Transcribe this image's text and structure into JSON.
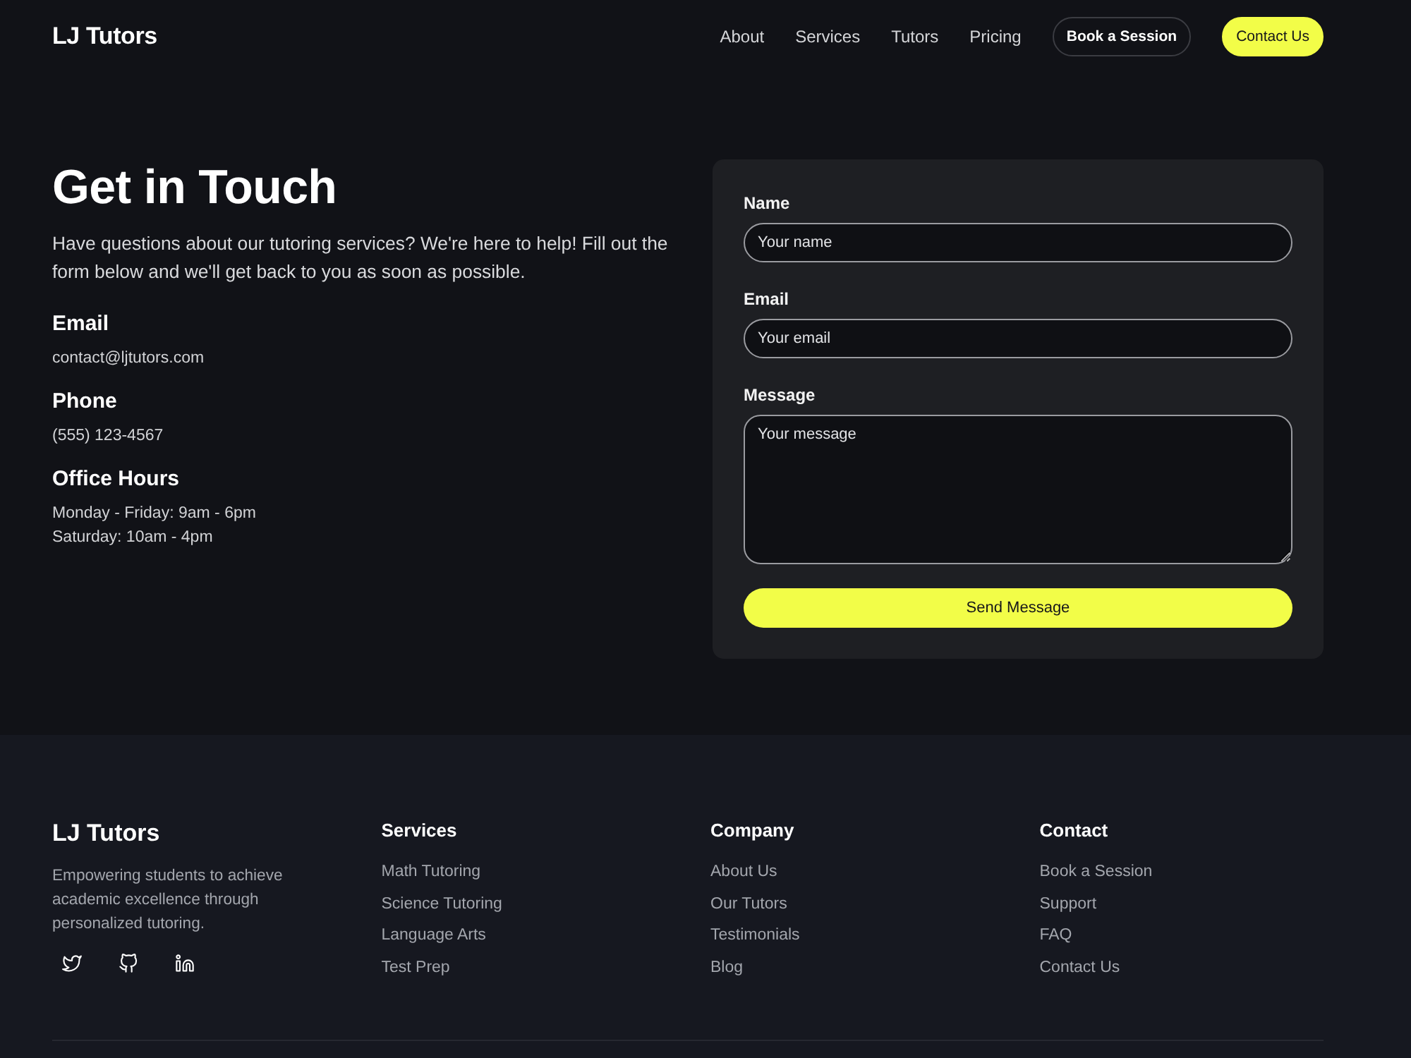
{
  "header": {
    "logo": "LJ Tutors",
    "nav_links": [
      "About",
      "Services",
      "Tutors",
      "Pricing"
    ],
    "buttons": [
      {
        "label": "Book a Session",
        "kind": "outline"
      },
      {
        "label": "Contact Us",
        "kind": "primary"
      }
    ]
  },
  "contact": {
    "title": "Get in Touch",
    "intro": "Have questions about our tutoring services? We're here to help! Fill out the form below and we'll get back to you as soon as possible.",
    "details": [
      {
        "heading": "Email",
        "lines": [
          "contact@ljtutors.com"
        ]
      },
      {
        "heading": "Phone",
        "lines": [
          "(555) 123-4567"
        ]
      },
      {
        "heading": "Office Hours",
        "lines": [
          "Monday - Friday: 9am - 6pm",
          "Saturday: 10am - 4pm"
        ]
      }
    ]
  },
  "form": {
    "fields": [
      {
        "label": "Name",
        "placeholder": "Your name",
        "kind": "input"
      },
      {
        "label": "Email",
        "placeholder": "Your email",
        "kind": "input"
      },
      {
        "label": "Message",
        "placeholder": "Your message",
        "kind": "textarea"
      }
    ],
    "submit": "Send Message"
  },
  "footer": {
    "brand": "LJ Tutors",
    "tagline": "Empowering students to achieve academic excellence through personalized tutoring.",
    "columns": [
      {
        "heading": "Services",
        "links": [
          "Math Tutoring",
          "Science Tutoring",
          "Language Arts",
          "Test Prep"
        ]
      },
      {
        "heading": "Company",
        "links": [
          "About Us",
          "Our Tutors",
          "Testimonials",
          "Blog"
        ]
      },
      {
        "heading": "Contact",
        "links": [
          "Book a Session",
          "Support",
          "FAQ",
          "Contact Us"
        ]
      }
    ]
  }
}
